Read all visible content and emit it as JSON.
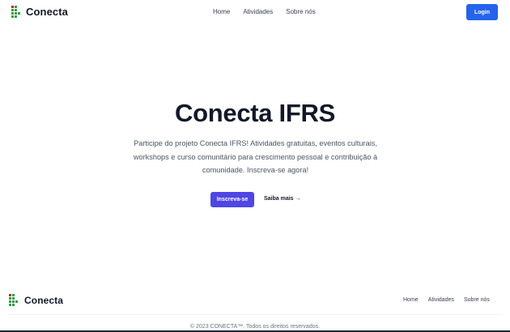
{
  "header": {
    "brand_name": "Conecta",
    "nav": [
      "Home",
      "Atividades",
      "Sobre nós"
    ],
    "login_label": "Login"
  },
  "hero": {
    "title": "Conecta IFRS",
    "description": "Participe do projeto Conecta IFRS! Atividades gratuitas, eventos culturais, workshops e curso comunitário para crescimento pessoal e contribuição à comunidade. Inscreva-se agora!",
    "primary_cta": "Inscreva-se",
    "secondary_cta": "Saiba mais →"
  },
  "footer": {
    "brand_name": "Conecta",
    "nav": [
      "Home",
      "Atividades",
      "Sobre nós"
    ],
    "copyright": "© 2023 CONECTA™. Todos os direitos reservados."
  },
  "colors": {
    "logo_green": "#2f9e41",
    "logo_red": "#cd191e",
    "login_button": "#2563eb",
    "primary_button": "#4f46e5",
    "heading": "#111827",
    "body_text": "#4b5563"
  },
  "icons": {
    "logo": "ifrs-logo-icon"
  }
}
